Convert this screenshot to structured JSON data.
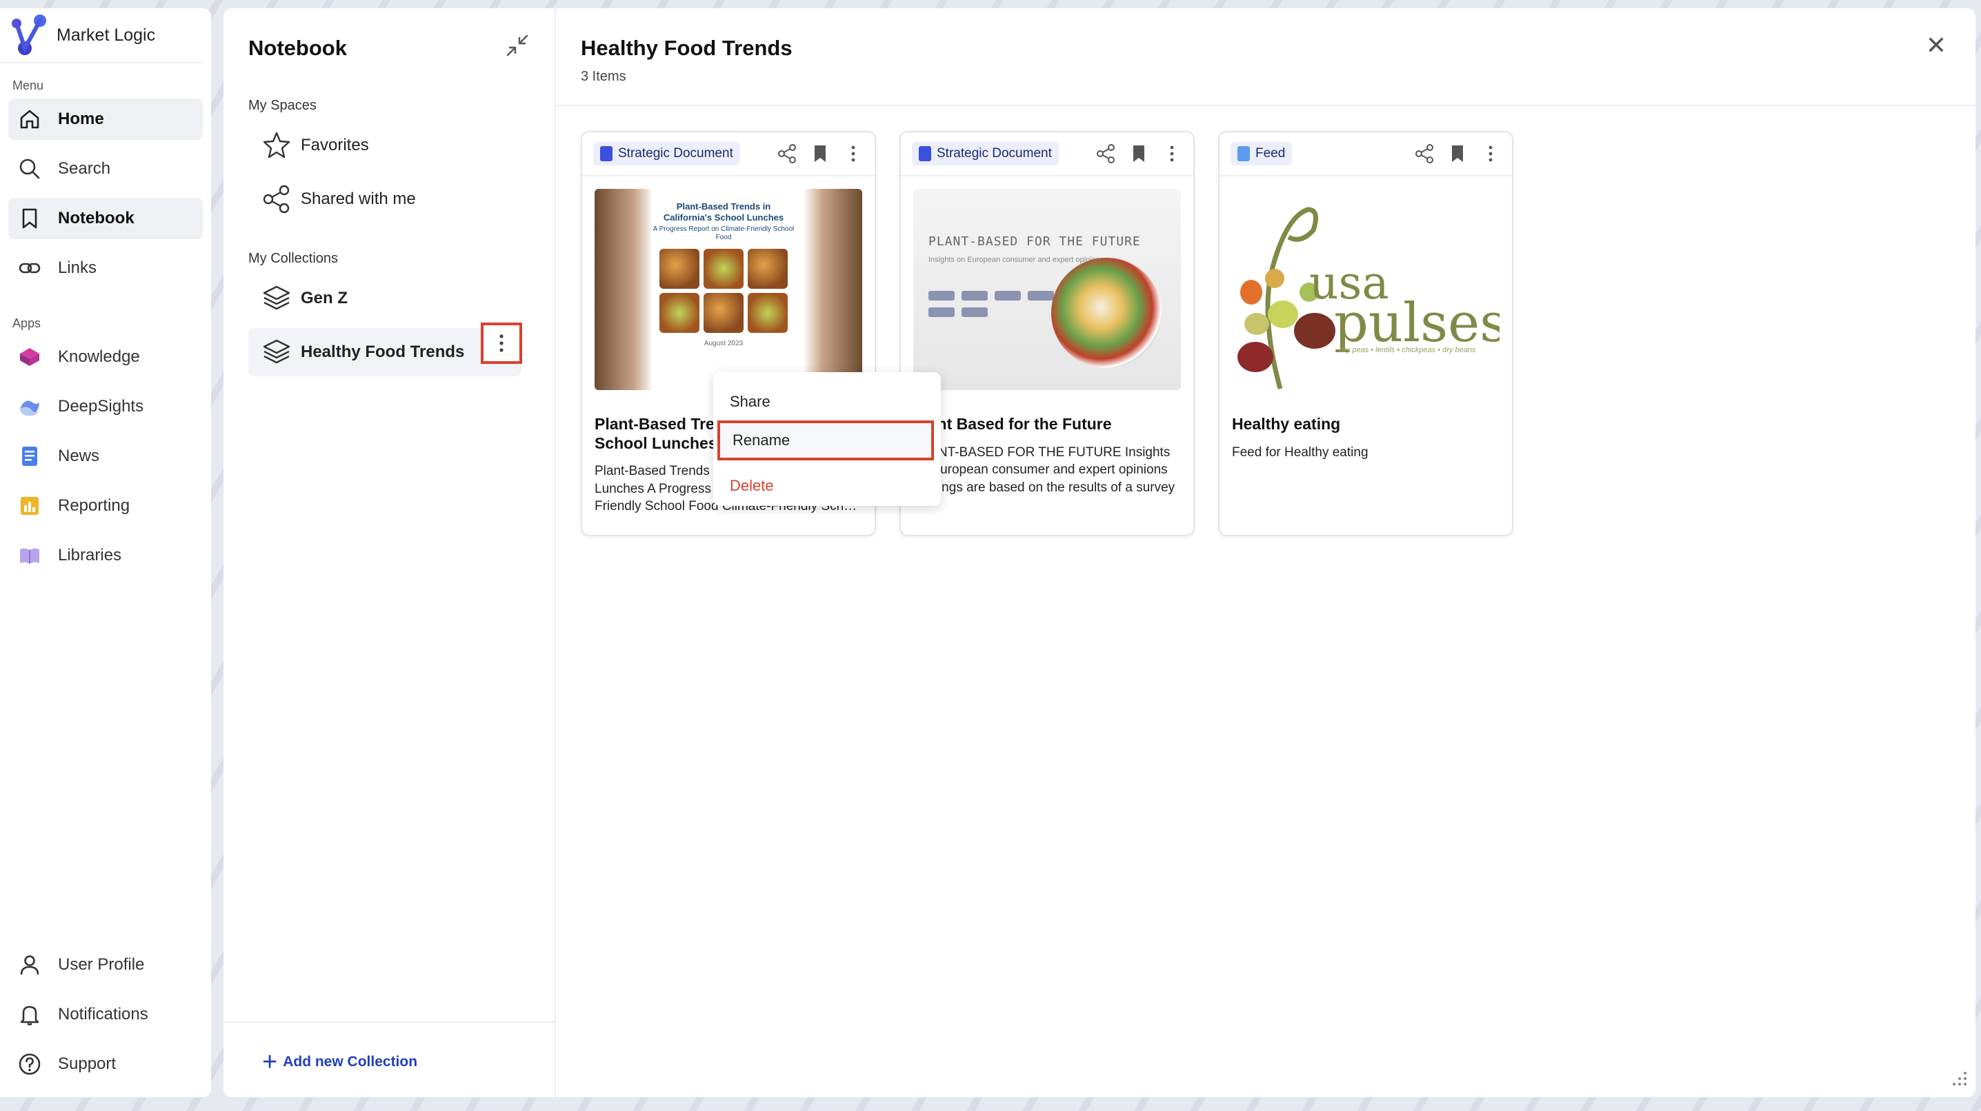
{
  "app": {
    "brand": "Market Logic"
  },
  "sidebar": {
    "menu_label": "Menu",
    "apps_label": "Apps",
    "menu_items": [
      {
        "label": "Home",
        "icon": "home-icon"
      },
      {
        "label": "Search",
        "icon": "search-icon"
      },
      {
        "label": "Notebook",
        "icon": "bookmark-icon"
      },
      {
        "label": "Links",
        "icon": "link-icon"
      }
    ],
    "app_items": [
      {
        "label": "Knowledge",
        "icon": "knowledge-icon"
      },
      {
        "label": "DeepSights",
        "icon": "deepsights-icon"
      },
      {
        "label": "News",
        "icon": "news-icon"
      },
      {
        "label": "Reporting",
        "icon": "reporting-icon"
      },
      {
        "label": "Libraries",
        "icon": "libraries-icon"
      }
    ],
    "bottom_items": [
      {
        "label": "User Profile",
        "icon": "user-icon"
      },
      {
        "label": "Notifications",
        "icon": "bell-icon"
      },
      {
        "label": "Support",
        "icon": "help-icon"
      }
    ]
  },
  "notebook": {
    "title": "Notebook",
    "my_spaces_label": "My Spaces",
    "spaces": [
      {
        "label": "Favorites",
        "icon": "star-icon"
      },
      {
        "label": "Shared with me",
        "icon": "share-icon"
      }
    ],
    "my_collections_label": "My Collections",
    "collections": [
      {
        "label": "Gen Z",
        "icon": "layers-icon"
      },
      {
        "label": "Healthy Food Trends",
        "icon": "layers-icon"
      }
    ],
    "add_collection_label": "Add new Collection"
  },
  "context_menu": {
    "items": [
      "Share",
      "Rename",
      "Delete"
    ]
  },
  "content": {
    "title": "Healthy Food Trends",
    "count": "3 Items",
    "cards": [
      {
        "badge": "Strategic Document",
        "title": "Plant-Based Trends in California School Lunches - Final",
        "desc": "Plant-Based Trends in California's School Lunches A Progress Report on Climate-Friendly School Food Climate-Friendly School Food",
        "thumb_heading": "Plant-Based Trends in California's School Lunches",
        "thumb_sub": "A Progress Report on Climate-Friendly School Food",
        "thumb_date": "August 2023"
      },
      {
        "badge": "Strategic Document",
        "title": "Plant Based for the Future",
        "desc": "PLANT-BASED FOR THE FUTURE Insights on European consumer and expert opinions Findings are based on the results of a survey",
        "thumb_heading": "PLANT-BASED FOR THE FUTURE",
        "thumb_sub": "Insights on European consumer and expert opinions"
      },
      {
        "badge": "Feed",
        "title": "Healthy eating",
        "desc": "Feed for Healthy eating",
        "thumb_word1": "usa",
        "thumb_word2": "pulses",
        "thumb_tag": "dry peas • lentils • chickpeas • dry beans"
      }
    ]
  },
  "colors": {
    "accent_blue": "#1f3fbf",
    "highlight_red": "#d9412e",
    "badge_bg": "#eceefb"
  }
}
